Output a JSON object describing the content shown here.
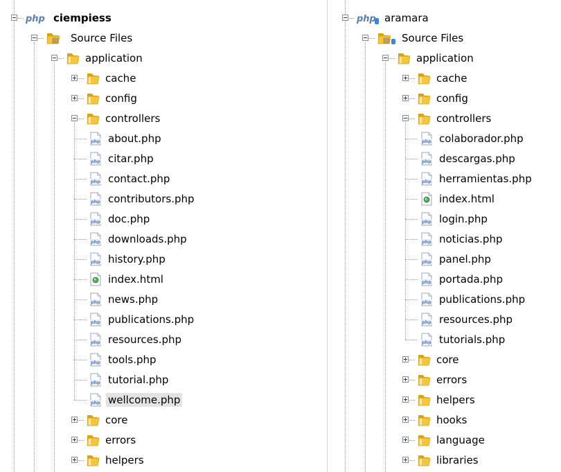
{
  "left_tree": {
    "root": {
      "label": "ciempiess",
      "badge": "php"
    },
    "source_files": "Source Files",
    "application": "application",
    "folders_before": [
      "cache",
      "config"
    ],
    "controllers": "controllers",
    "files": [
      {
        "name": "about.php",
        "kind": "php"
      },
      {
        "name": "citar.php",
        "kind": "php"
      },
      {
        "name": "contact.php",
        "kind": "php"
      },
      {
        "name": "contributors.php",
        "kind": "php"
      },
      {
        "name": "doc.php",
        "kind": "php"
      },
      {
        "name": "downloads.php",
        "kind": "php"
      },
      {
        "name": "history.php",
        "kind": "php"
      },
      {
        "name": "index.html",
        "kind": "html"
      },
      {
        "name": "news.php",
        "kind": "php"
      },
      {
        "name": "publications.php",
        "kind": "php"
      },
      {
        "name": "resources.php",
        "kind": "php"
      },
      {
        "name": "tools.php",
        "kind": "php"
      },
      {
        "name": "tutorial.php",
        "kind": "php"
      },
      {
        "name": "wellcome.php",
        "kind": "php",
        "selected": true
      }
    ],
    "folders_after": [
      "core",
      "errors",
      "helpers"
    ]
  },
  "right_tree": {
    "root": {
      "label": "aramara",
      "badge": "php"
    },
    "source_files": "Source Files",
    "application": "application",
    "folders_before": [
      "cache",
      "config"
    ],
    "controllers": "controllers",
    "files": [
      {
        "name": "colaborador.php",
        "kind": "php"
      },
      {
        "name": "descargas.php",
        "kind": "php"
      },
      {
        "name": "herramientas.php",
        "kind": "php"
      },
      {
        "name": "index.html",
        "kind": "html"
      },
      {
        "name": "login.php",
        "kind": "php"
      },
      {
        "name": "noticias.php",
        "kind": "php"
      },
      {
        "name": "panel.php",
        "kind": "php"
      },
      {
        "name": "portada.php",
        "kind": "php"
      },
      {
        "name": "publications.php",
        "kind": "php"
      },
      {
        "name": "resources.php",
        "kind": "php"
      },
      {
        "name": "tutorials.php",
        "kind": "php"
      }
    ],
    "folders_after": [
      "core",
      "errors",
      "helpers",
      "hooks",
      "language",
      "libraries"
    ]
  },
  "colors": {
    "folder": "#f5c53b",
    "folder_dark": "#d9a21b",
    "php_badge": "#5a7fb0",
    "html_icon": "#58b05a",
    "versioned_badge": "#3f86d6",
    "selection": "#e3e3e3"
  },
  "icons": {
    "project": "php-project-icon",
    "source_files": "source-package-icon",
    "folder": "folder-icon",
    "php_file": "php-file-icon",
    "html_file": "html-file-icon",
    "expand": "plus-expander-icon",
    "collapse": "minus-expander-icon"
  }
}
